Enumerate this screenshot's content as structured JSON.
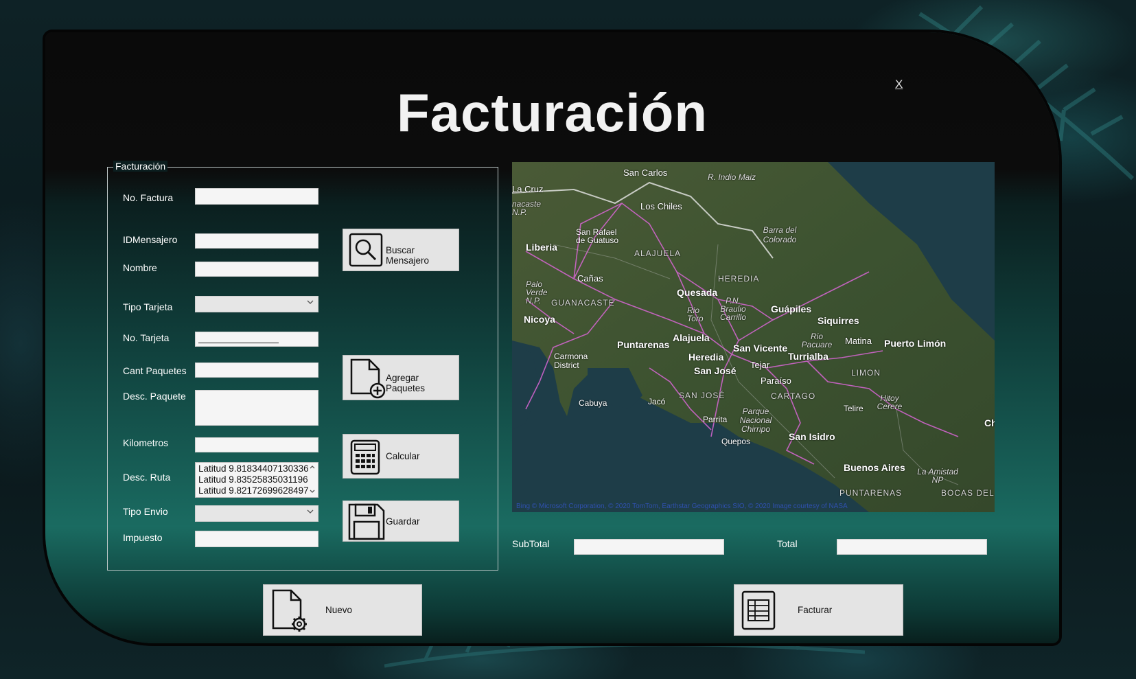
{
  "window": {
    "title": "Facturación",
    "close_label": "X"
  },
  "group": {
    "legend": "Facturación",
    "fields": {
      "no_factura": {
        "label": "No. Factura",
        "value": ""
      },
      "id_mensajero": {
        "label": "IDMensajero",
        "value": ""
      },
      "nombre": {
        "label": "Nombre",
        "value": ""
      },
      "tipo_tarjeta": {
        "label": "Tipo Tarjeta",
        "value": ""
      },
      "no_tarjeta": {
        "label": "No. Tarjeta",
        "value": ""
      },
      "cant_paquetes": {
        "label": "Cant Paquetes",
        "value": ""
      },
      "desc_paquete": {
        "label": "Desc. Paquete",
        "value": ""
      },
      "kilometros": {
        "label": "Kilometros",
        "value": ""
      },
      "desc_ruta": {
        "label": "Desc. Ruta",
        "items": [
          "Latitud 9.81834407130336",
          "Latitud 9.83525835031196",
          "Latitud 9.82172699628497"
        ]
      },
      "tipo_envio": {
        "label": "Tipo Envio",
        "value": ""
      },
      "impuesto": {
        "label": "Impuesto",
        "value": ""
      }
    },
    "buttons": {
      "buscar": "Buscar Mensajero",
      "agregar": "Agregar Paquetes",
      "calcular": "Calcular",
      "guardar": "Guardar"
    }
  },
  "totals": {
    "subtotal_label": "SubTotal",
    "subtotal_value": "",
    "total_label": "Total",
    "total_value": ""
  },
  "bottom_buttons": {
    "nuevo": "Nuevo",
    "facturar": "Facturar"
  },
  "map": {
    "labels": {
      "san_carlos": "San Carlos",
      "rio_indio_maiz": "R. Indio Maiz",
      "la_cruz": "La Cruz",
      "nacaste": "nacaste",
      "np": "N.P.",
      "los_chiles": "Los Chiles",
      "barra_del_colorado": "Barra del Colorado",
      "san_rafael": "San Rafael de Guatuso",
      "liberia": "Liberia",
      "alajuela_region": "ALAJUELA",
      "heredia_region": "HEREDIA",
      "canas": "Cañas",
      "palo_verde": "Palo Verde N.P.",
      "guanacaste": "GUANACASTE",
      "quesada": "Quesada",
      "rio_toro": "Rio Toro",
      "braulio": "P.N. Braulio Carrillo",
      "guapiles": "Guápiles",
      "siquirres": "Siquirres",
      "nicoya": "Nicoya",
      "alajuela": "Alajuela",
      "puntarenas": "Puntarenas",
      "heredia": "Heredia",
      "san_vicente": "San Vicente",
      "rio_pacuare": "Rio Pacuare",
      "matina": "Matina",
      "puerto_limon": "Puerto Limón",
      "turrialba": "Turrialba",
      "carmona": "Carmona District",
      "san_jose": "San José",
      "tejar": "Tejar",
      "limon_region": "LIMON",
      "paraiso": "Paraíso",
      "cabuya": "Cabuya",
      "jaco": "Jacó",
      "san_jose_region": "SAN JOSÉ",
      "cartago": "CARTAGO",
      "hitoy": "Hitoy Cerere",
      "telire": "Telire",
      "parque_chirripo": "Parque Nacional Chirripo",
      "parrita": "Parrita",
      "quepos": "Quepos",
      "san_isidro": "San Isidro",
      "ch": "Ch",
      "buenos_aires": "Buenos Aires",
      "la_amistad": "La Amistad NP",
      "puntarenas_region": "PUNTARENAS",
      "bocas": "BOCAS DEL T"
    },
    "attribution": "Bing © Microsoft Corporation, © 2020 TomTom, Earthstar Geographics SIO, © 2020 Image courtesy of NASA"
  }
}
